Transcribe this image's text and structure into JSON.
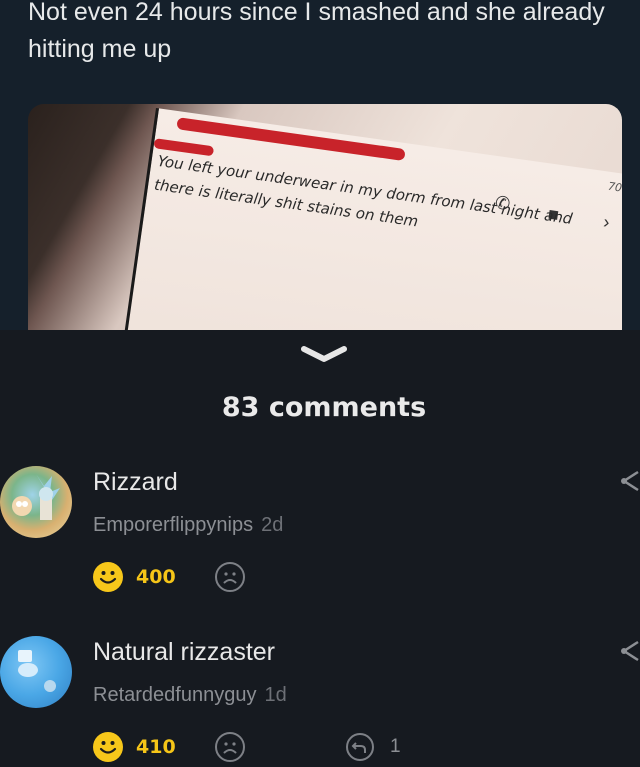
{
  "post": {
    "text": "Not even 24 hours since I smashed and she already hitting me up",
    "image_message": "You left your underwear in my dorm from last night and there is literally shit stains on them",
    "image_battery": "70%"
  },
  "comments_header": "83 comments",
  "comments": [
    {
      "title": "Rizzard",
      "username": "Emporerflippynips",
      "time": "2d",
      "upvotes": "400"
    },
    {
      "title": "Natural rizzaster",
      "username": "Retardedfunnyguy",
      "time": "1d",
      "upvotes": "410",
      "replies": "1"
    }
  ],
  "colors": {
    "background": "#161a20",
    "upvote_accent": "#f5c518",
    "redaction": "#c8232a"
  }
}
